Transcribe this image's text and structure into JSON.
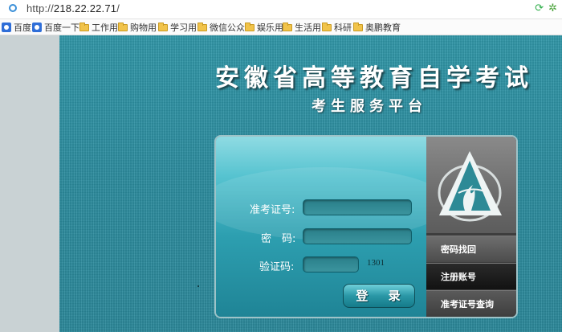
{
  "browser": {
    "url_scheme": "http://",
    "url_host": "218.22.22.71",
    "url_path": "/"
  },
  "bookmarks": [
    {
      "label": "百度",
      "icon": "baidu-paw-icon"
    },
    {
      "label": "百度一下",
      "icon": "baidu-paw-icon"
    },
    {
      "label": "工作用",
      "icon": "folder-icon"
    },
    {
      "label": "购物用",
      "icon": "folder-icon"
    },
    {
      "label": "学习用",
      "icon": "folder-icon"
    },
    {
      "label": "微信公众",
      "icon": "folder-icon"
    },
    {
      "label": "娱乐用",
      "icon": "folder-icon"
    },
    {
      "label": "生活用",
      "icon": "folder-icon"
    },
    {
      "label": "科研",
      "icon": "folder-icon"
    },
    {
      "label": "奥鹏教育",
      "icon": "folder-icon"
    }
  ],
  "header": {
    "title": "安徽省高等教育自学考试",
    "subtitle": "考生服务平台"
  },
  "login": {
    "exam_id_label": "准考证号:",
    "password_label": "密　码:",
    "captcha_label": "验证码:",
    "captcha_value": "1301",
    "exam_id_value": "",
    "password_value": "",
    "captcha_input_value": "",
    "submit_label": "登 录"
  },
  "side_links": {
    "recover_password": "密码找回",
    "register": "注册账号",
    "exam_id_lookup": "准考证号查询"
  },
  "colors": {
    "page_bg": "#2d8ea0",
    "panel_side": "#3d3d3d",
    "button": "#2a97a6"
  }
}
